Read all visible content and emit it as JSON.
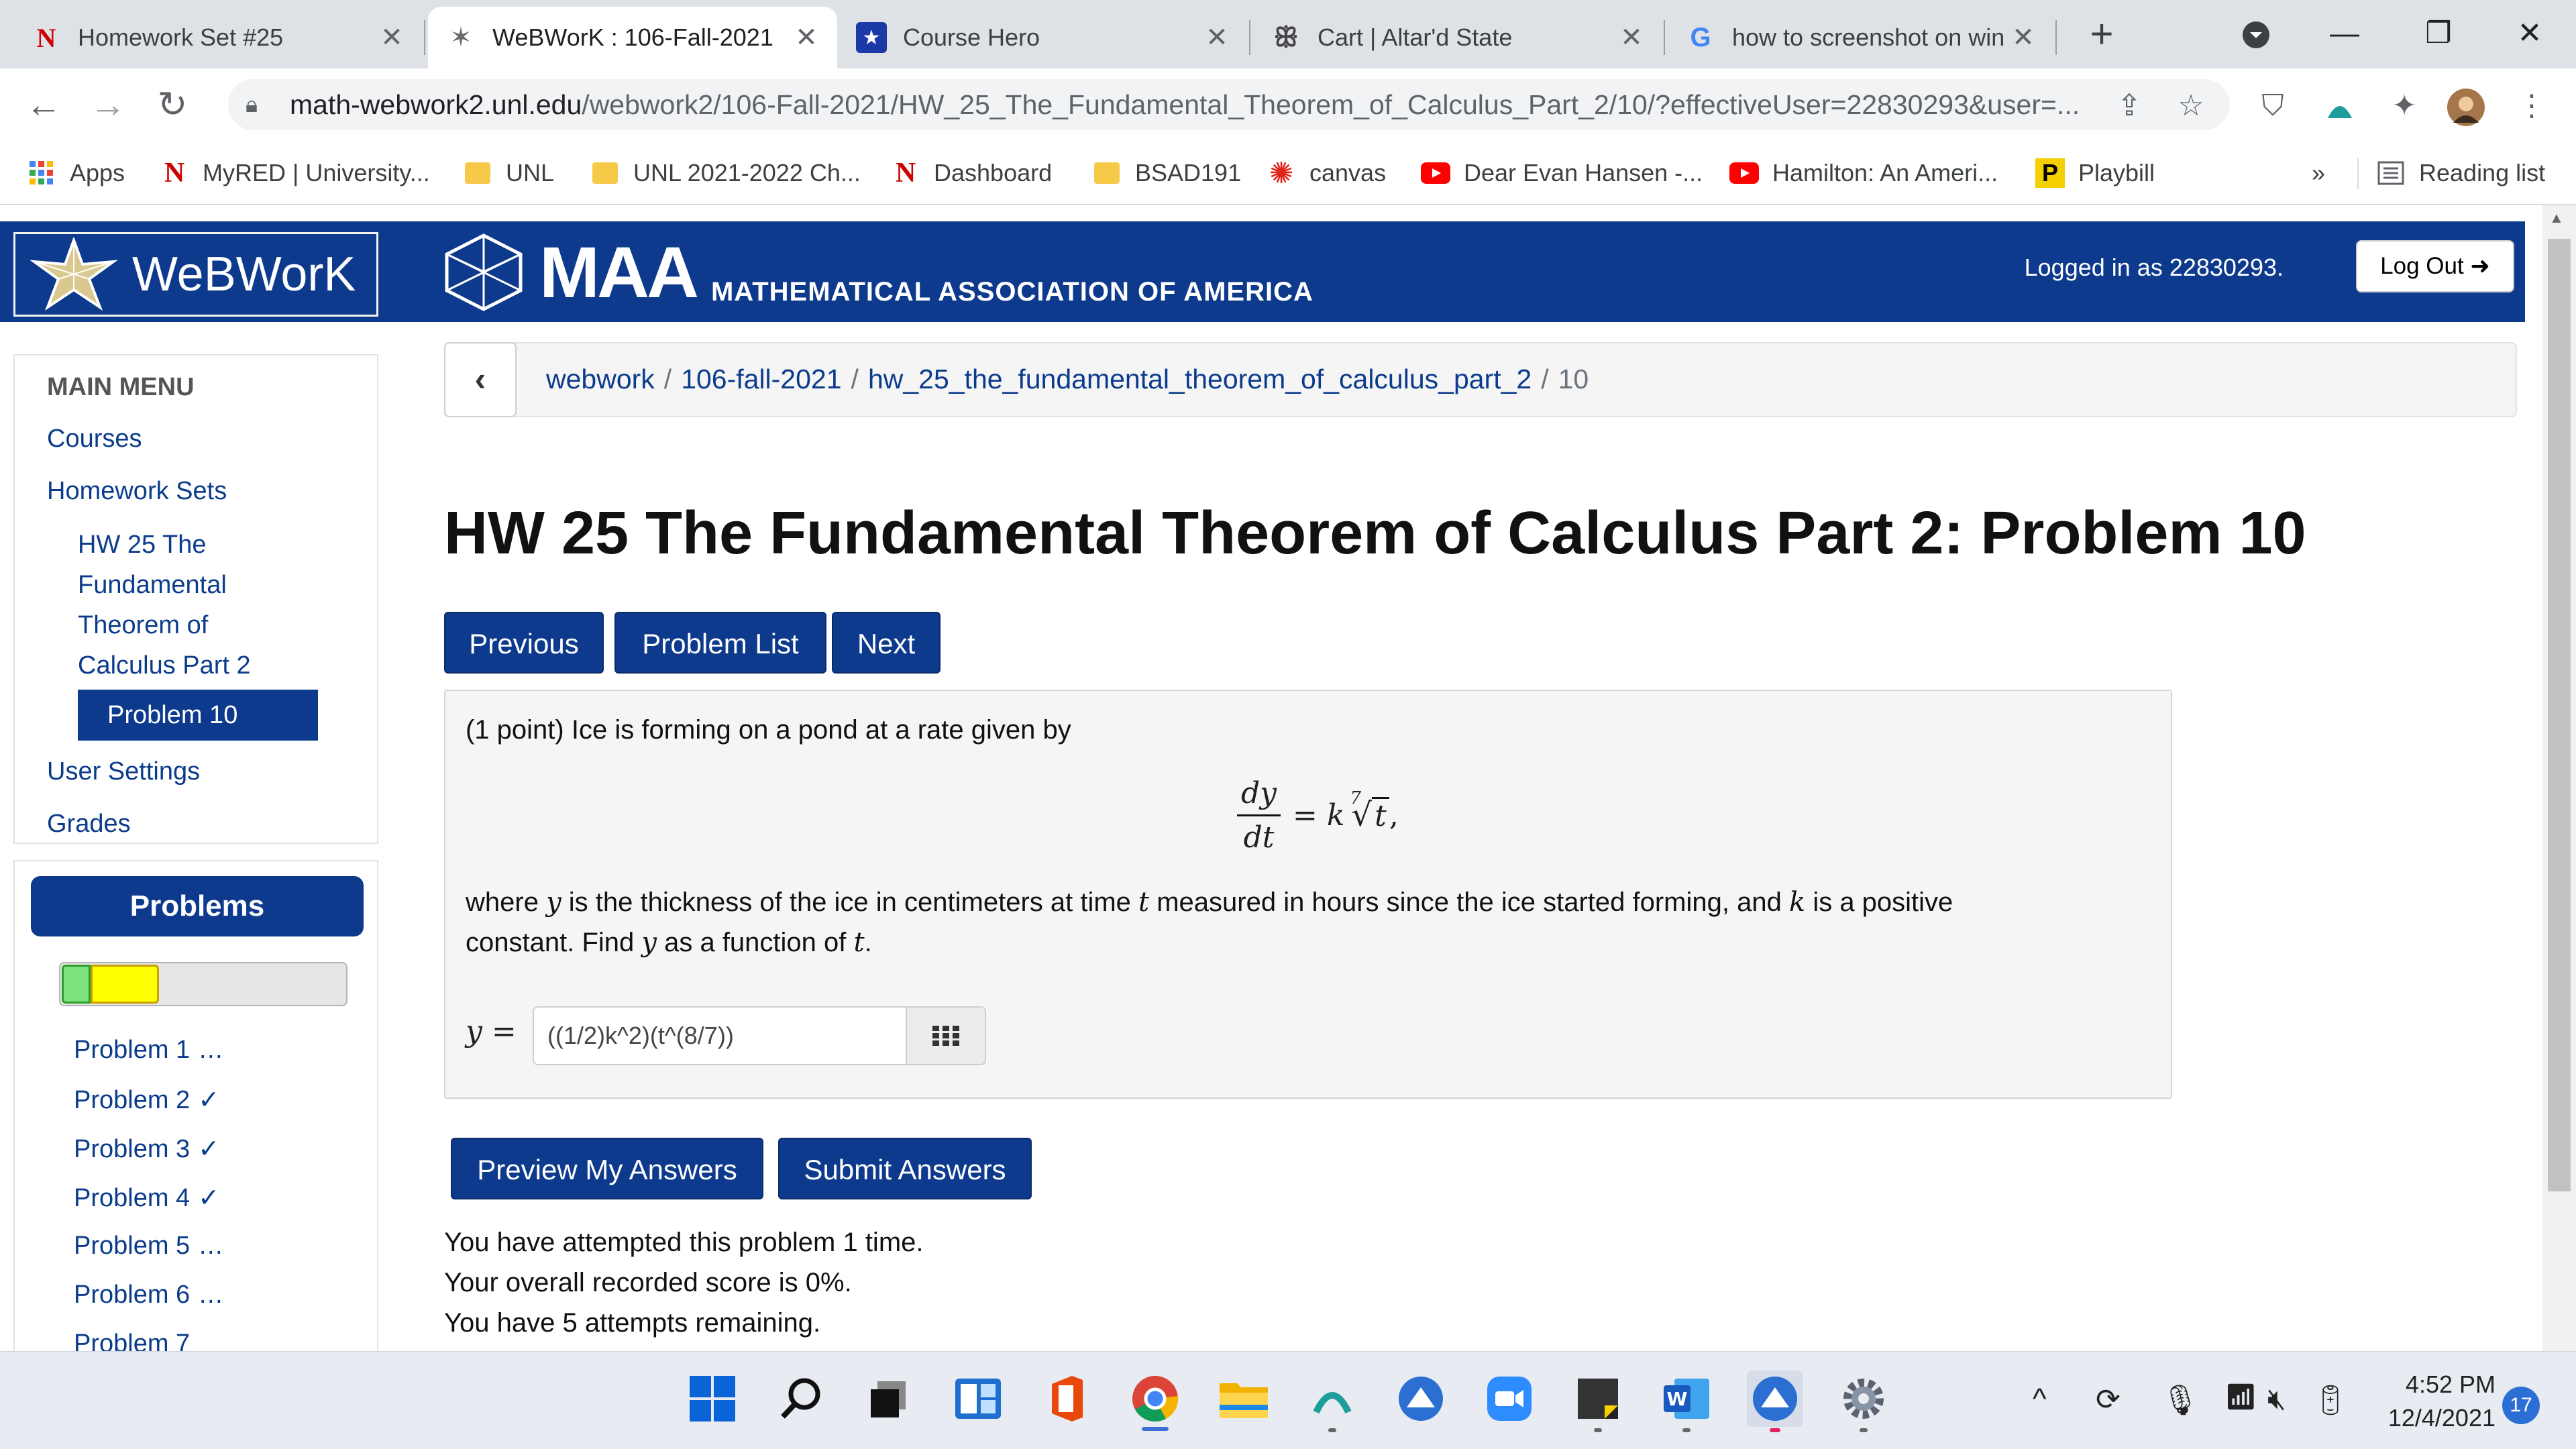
{
  "browser": {
    "tabs": [
      {
        "title": "Homework Set #25",
        "icon": "N"
      },
      {
        "title": "WeBWorK : 106-Fall-2021",
        "icon": "star"
      },
      {
        "title": "Course Hero",
        "icon": "star"
      },
      {
        "title": "Cart | Altar'd State",
        "icon": "butterfly"
      },
      {
        "title": "how to screenshot on win",
        "icon": "G"
      }
    ],
    "url_host": "math-webwork2.unl.edu",
    "url_path": "/webwork2/106-Fall-2021/HW_25_The_Fundamental_Theorem_of_Calculus_Part_2/10/?effectiveUser=22830293&user=...",
    "bookmarks": [
      {
        "label": "Apps"
      },
      {
        "label": "MyRED | University..."
      },
      {
        "label": "UNL"
      },
      {
        "label": "UNL 2021-2022 Ch..."
      },
      {
        "label": "Dashboard"
      },
      {
        "label": "BSAD191"
      },
      {
        "label": "canvas"
      },
      {
        "label": "Dear Evan Hansen -..."
      },
      {
        "label": "Hamilton: An Ameri..."
      },
      {
        "label": "Playbill"
      }
    ],
    "more_bookmarks": "»",
    "reading_list": "Reading list"
  },
  "header": {
    "logo_text": "WeBWorK",
    "maa_big": "MAA",
    "maa_sub": "MATHEMATICAL ASSOCIATION OF AMERICA",
    "logged_in": "Logged in as 22830293.",
    "logout": "Log Out"
  },
  "sidebar": {
    "heading": "MAIN MENU",
    "courses": "Courses",
    "homework_sets": "Homework Sets",
    "set_name_lines": [
      "HW 25 The",
      "Fundamental",
      "Theorem of",
      "Calculus Part 2"
    ],
    "current_problem": "Problem 10",
    "user_settings": "User Settings",
    "grades": "Grades",
    "problems_heading": "Problems",
    "progress": {
      "correct_fraction": 0.1,
      "partial_fraction": 0.24,
      "green": "#7ee27e",
      "yellow": "#ffff00"
    },
    "problem_list": [
      {
        "label": "Problem 1",
        "status": "…"
      },
      {
        "label": "Problem 2",
        "status": "✓"
      },
      {
        "label": "Problem 3",
        "status": "✓"
      },
      {
        "label": "Problem 4",
        "status": "✓"
      },
      {
        "label": "Problem 5",
        "status": "…"
      },
      {
        "label": "Problem 6",
        "status": "…"
      },
      {
        "label": "Problem 7",
        "status": ""
      }
    ]
  },
  "breadcrumb": {
    "items": [
      "webwork",
      "106-fall-2021",
      "hw_25_the_fundamental_theorem_of_calculus_part_2"
    ],
    "current": "10",
    "sep": "/"
  },
  "main": {
    "title": "HW 25 The Fundamental Theorem of Calculus Part 2: Problem 10",
    "nav": {
      "previous": "Previous",
      "list": "Problem List",
      "next": "Next"
    },
    "problem": {
      "intro": "(1 point) Ice is forming on a pond at a rate given by",
      "eq_num": "dy",
      "eq_den": "dt",
      "eq_rhs_k": "= k",
      "eq_root_index": "7",
      "eq_radicand": "t",
      "eq_tail": ",",
      "line1_a": "where ",
      "var_y": "y",
      "line1_b": " is the thickness of the ice in centimeters at time ",
      "var_t": "t",
      "line1_c": " measured in hours since the ice started forming, and ",
      "var_k": "k",
      "line1_d": " is a positive",
      "line2_a": "constant. Find ",
      "line2_b": " as a function of ",
      "line2_c": ".",
      "answer_label": "y =",
      "answer_value": "((1/2)k^2)(t^(8/7))"
    },
    "buttons": {
      "preview": "Preview My Answers",
      "submit": "Submit Answers"
    },
    "attempts": [
      "You have attempted this problem 1 time.",
      "Your overall recorded score is 0%.",
      "You have 5 attempts remaining."
    ]
  },
  "taskbar": {
    "time": "4:52 PM",
    "date": "12/4/2021",
    "notifications": "17"
  }
}
